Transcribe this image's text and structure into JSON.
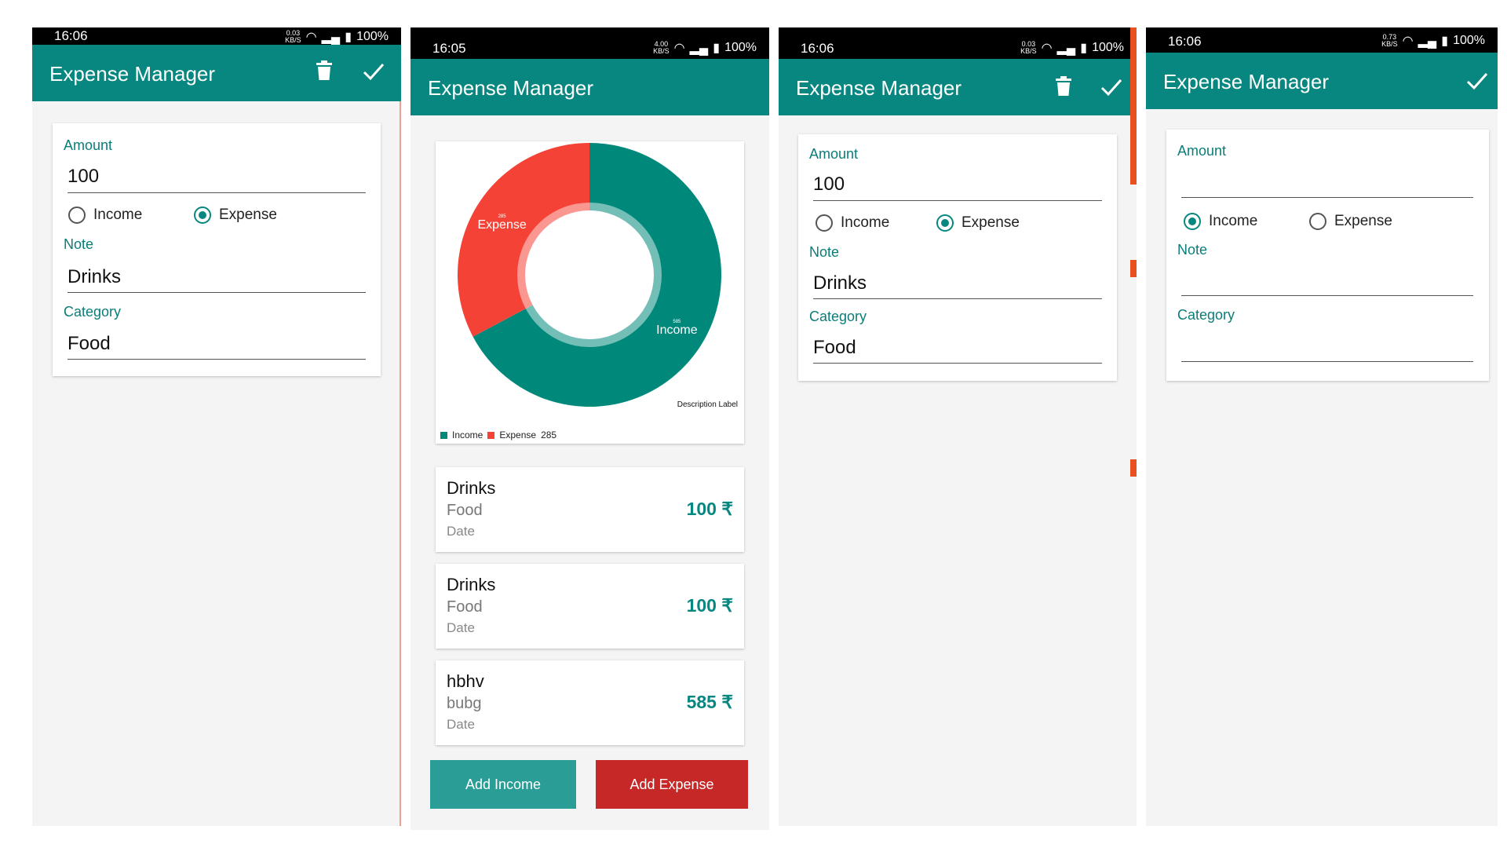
{
  "app": {
    "title": "Expense Manager"
  },
  "colors": {
    "primary": "#07877f",
    "income": "#00897b",
    "expense": "#f44336",
    "expense_button": "#c62828",
    "income_button": "#2a9d97"
  },
  "icons": {
    "delete": "trash-icon",
    "confirm": "check-icon",
    "wifi": "wifi-icon",
    "signal": "signal-icon",
    "battery": "battery-icon"
  },
  "form_labels": {
    "amount": "Amount",
    "note": "Note",
    "category": "Category",
    "income": "Income",
    "expense": "Expense"
  },
  "screen1": {
    "time": "16:06",
    "net_top": "0.03",
    "net_bottom": "KB/S",
    "battery": "100%",
    "amount": "100",
    "note": "Drinks",
    "category": "Food",
    "selected": "expense"
  },
  "screen2": {
    "time": "16:05",
    "net_top": "4.00",
    "net_bottom": "KB/S",
    "battery": "100%",
    "chart_data": {
      "type": "pie",
      "labels": [
        "Income",
        "Expense"
      ],
      "values": [
        585,
        285
      ],
      "slice_value_labels": [
        "585",
        "285"
      ],
      "colors": [
        "#00897b",
        "#f44336"
      ],
      "hole": true,
      "description": "Description Label",
      "legend": [
        "Income",
        "Expense"
      ],
      "legend_extra": "285",
      "legend_position": "bottom-left"
    },
    "transactions": [
      {
        "note": "Drinks",
        "category": "Food",
        "date": "Date",
        "amount": "100 ₹"
      },
      {
        "note": "Drinks",
        "category": "Food",
        "date": "Date",
        "amount": "100 ₹"
      },
      {
        "note": "hbhv",
        "category": "bubg",
        "date": "Date",
        "amount": "585 ₹"
      }
    ],
    "buttons": {
      "add_income": "Add Income",
      "add_expense": "Add Expense"
    }
  },
  "screen3": {
    "time": "16:06",
    "net_top": "0.03",
    "net_bottom": "KB/S",
    "battery": "100%",
    "amount": "100",
    "note": "Drinks",
    "category": "Food",
    "selected": "expense"
  },
  "screen4": {
    "time": "16:06",
    "net_top": "0.73",
    "net_bottom": "KB/S",
    "battery": "100%",
    "amount": "",
    "note": "",
    "category": "",
    "selected": "income"
  }
}
